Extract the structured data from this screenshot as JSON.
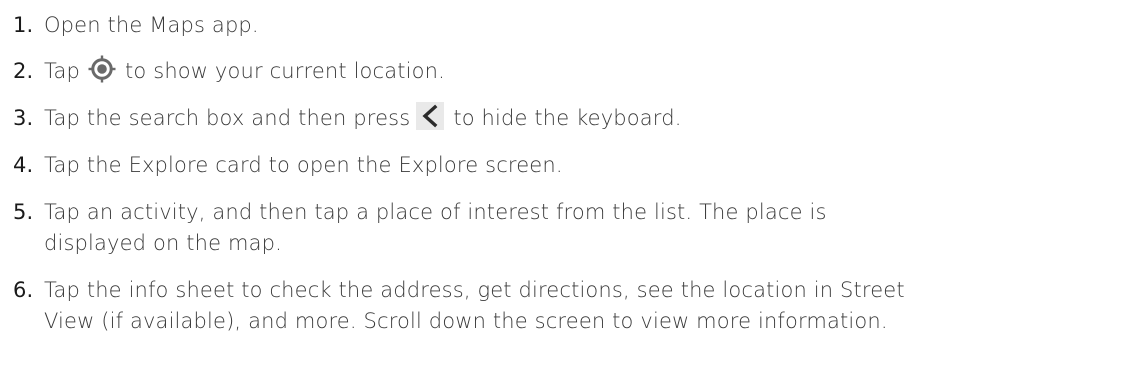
{
  "steps": [
    {
      "number": "1.",
      "parts": [
        "Open the Maps app."
      ]
    },
    {
      "number": "2.",
      "before": "Tap",
      "icon": "location-target-icon",
      "after": "to show your current location."
    },
    {
      "number": "3.",
      "before": "Tap the search box and then press",
      "icon": "back-chevron-icon",
      "after": "to hide the keyboard."
    },
    {
      "number": "4.",
      "parts": [
        "Tap the Explore card to open the Explore screen."
      ]
    },
    {
      "number": "5.",
      "parts": [
        "Tap an activity, and then tap a place of interest from the list. The place is",
        "displayed on the map."
      ]
    },
    {
      "number": "6.",
      "parts": [
        "Tap the info sheet to check the address, get directions, see the location in Street",
        "View (if available), and more. Scroll down the screen to view more information."
      ]
    }
  ],
  "colors": {
    "text": "#3a3a3a",
    "number": "#1a1a1a",
    "icon_gray": "#6a6a6a",
    "icon_bg": "#e9e9e9"
  }
}
